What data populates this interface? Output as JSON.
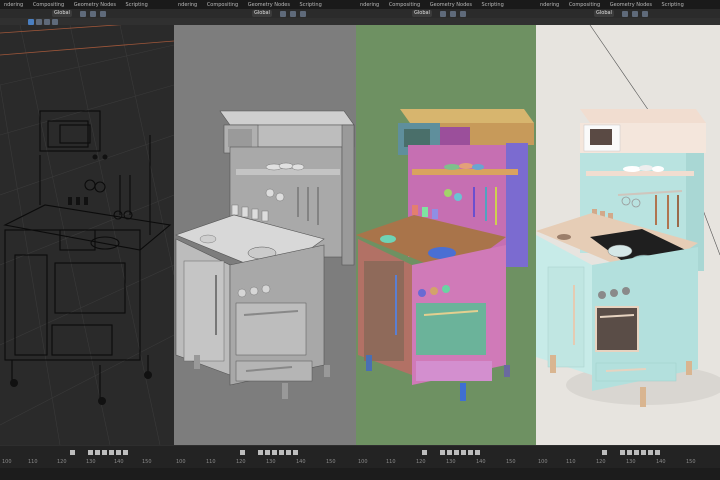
{
  "workspace_tabs": [
    "ndering",
    "Compositing",
    "Geometry Nodes",
    "Scripting"
  ],
  "orientation_label": "Global",
  "timeline": {
    "panel1_ticks": [
      "100",
      "110",
      "120",
      "130",
      "140",
      "150"
    ],
    "panel2_ticks": [
      "100",
      "110",
      "120",
      "130",
      "140",
      "150"
    ],
    "panel3_ticks": [
      "100",
      "110",
      "120",
      "130",
      "140",
      "150"
    ],
    "panel4_ticks": [
      "100",
      "110",
      "120",
      "130",
      "140",
      "150"
    ]
  },
  "panels": [
    {
      "shading": "wireframe",
      "background": "#2a2a2a"
    },
    {
      "shading": "solid",
      "background": "#7d7d7d"
    },
    {
      "shading": "random-color solid",
      "background": "#6e9162"
    },
    {
      "shading": "rendered",
      "background": "#e7e4df"
    }
  ]
}
